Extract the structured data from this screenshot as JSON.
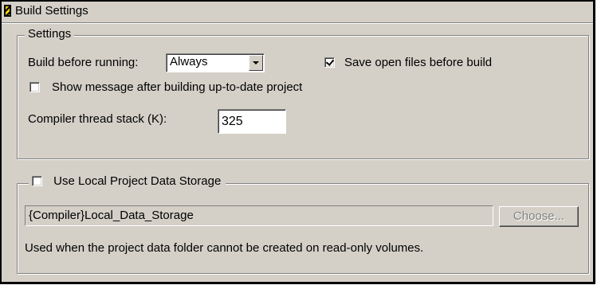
{
  "window": {
    "title": "Build Settings"
  },
  "settings_group": {
    "legend": "Settings",
    "build_before_running_label": "Build before running:",
    "build_before_running_value": "Always",
    "save_open_files_label": "Save open files before build",
    "save_open_files_checked": true,
    "show_message_label": "Show message after building up-to-date project",
    "show_message_checked": false,
    "thread_stack_label": "Compiler thread stack (K):",
    "thread_stack_value": "325"
  },
  "local_storage_group": {
    "legend": "Use Local Project Data Storage",
    "enabled": false,
    "path_value": "{Compiler}Local_Data_Storage",
    "choose_button_label": "Choose...",
    "choose_button_disabled": true,
    "description": "Used when the project data folder cannot be created on read-only volumes."
  }
}
